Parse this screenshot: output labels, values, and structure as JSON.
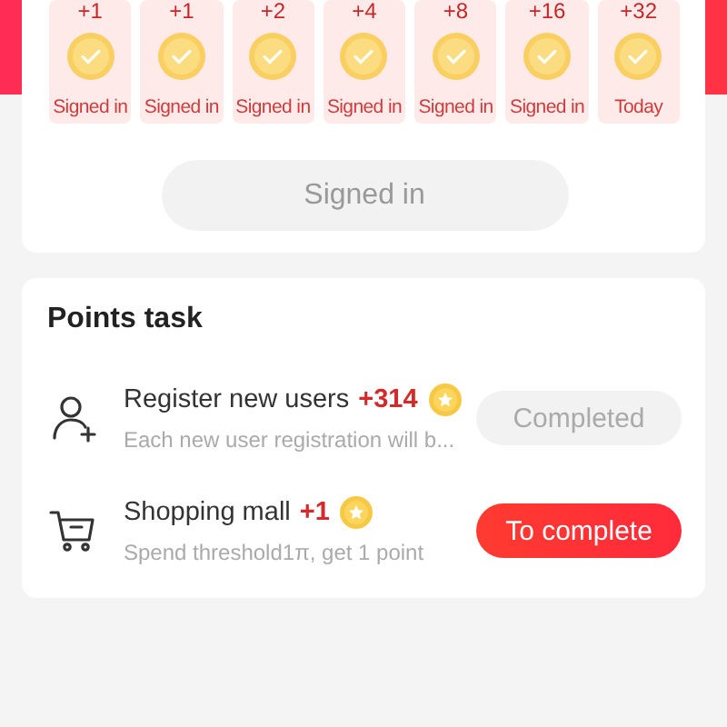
{
  "sign_days": [
    {
      "points": "+1",
      "label": "Signed in",
      "checked": true
    },
    {
      "points": "+1",
      "label": "Signed in",
      "checked": true
    },
    {
      "points": "+2",
      "label": "Signed in",
      "checked": true
    },
    {
      "points": "+4",
      "label": "Signed in",
      "checked": true
    },
    {
      "points": "+8",
      "label": "Signed in",
      "checked": true
    },
    {
      "points": "+16",
      "label": "Signed in",
      "checked": true
    },
    {
      "points": "+32",
      "label": "Today",
      "checked": true
    }
  ],
  "sign_button": {
    "label": "Signed in",
    "disabled": true
  },
  "points_task": {
    "title": "Points task",
    "tasks": [
      {
        "kind": "user-add",
        "title": "Register new users",
        "points": "+314",
        "description": "Each new user registration will b...",
        "button": {
          "label": "Completed",
          "completed": true
        }
      },
      {
        "kind": "cart",
        "title": "Shopping mall",
        "points": "+1",
        "description": "Spend threshold1π, get 1 point",
        "button": {
          "label": "To complete",
          "completed": false
        }
      }
    ]
  }
}
